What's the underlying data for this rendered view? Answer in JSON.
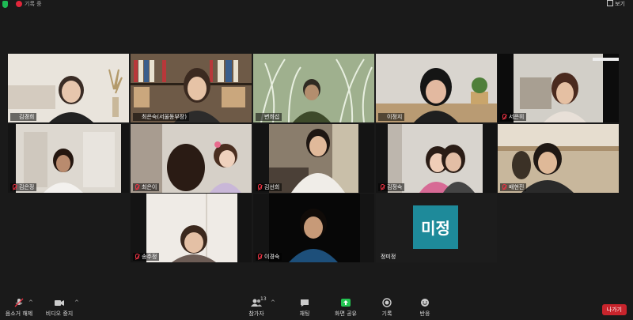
{
  "topbar": {
    "recording_label": "기록 중",
    "view_label": "보기"
  },
  "participants": [
    {
      "name": "김경희",
      "initial": "",
      "mic_muted": false,
      "active": true
    },
    {
      "name": "최은숙(서울동부장)",
      "initial": "",
      "mic_muted": false,
      "active": false
    },
    {
      "name": "변희섭",
      "initial": "",
      "mic_muted": false,
      "active": false
    },
    {
      "name": "이정지",
      "initial": "",
      "mic_muted": false,
      "active": false
    },
    {
      "name": "서은히",
      "initial": "",
      "mic_muted": true,
      "active": false
    },
    {
      "name": "김은정",
      "initial": "",
      "mic_muted": true,
      "active": false
    },
    {
      "name": "최은이",
      "initial": "",
      "mic_muted": true,
      "active": false
    },
    {
      "name": "김선희",
      "initial": "",
      "mic_muted": true,
      "active": false
    },
    {
      "name": "김정숙",
      "initial": "",
      "mic_muted": true,
      "active": false
    },
    {
      "name": "배현진",
      "initial": "",
      "mic_muted": true,
      "active": false
    },
    {
      "name": "송주정",
      "initial": "",
      "mic_muted": true,
      "active": false
    },
    {
      "name": "이경숙",
      "initial": "",
      "mic_muted": true,
      "active": false
    },
    {
      "name": "정미정",
      "initial": "미정",
      "mic_muted": false,
      "active": false
    }
  ],
  "toolbar": {
    "unmute_label": "음소거 해제",
    "stop_video_label": "비디오 중지",
    "participants_label": "참가자",
    "participants_count": "13",
    "chat_label": "채팅",
    "share_label": "화면 공유",
    "record_label": "기록",
    "reactions_label": "반응",
    "leave_label": "나가기"
  },
  "colors": {
    "active_border": "#c7e255",
    "share_green": "#23c552",
    "leave_red": "#c8242c",
    "initial_bg": "#1e8a9a"
  }
}
